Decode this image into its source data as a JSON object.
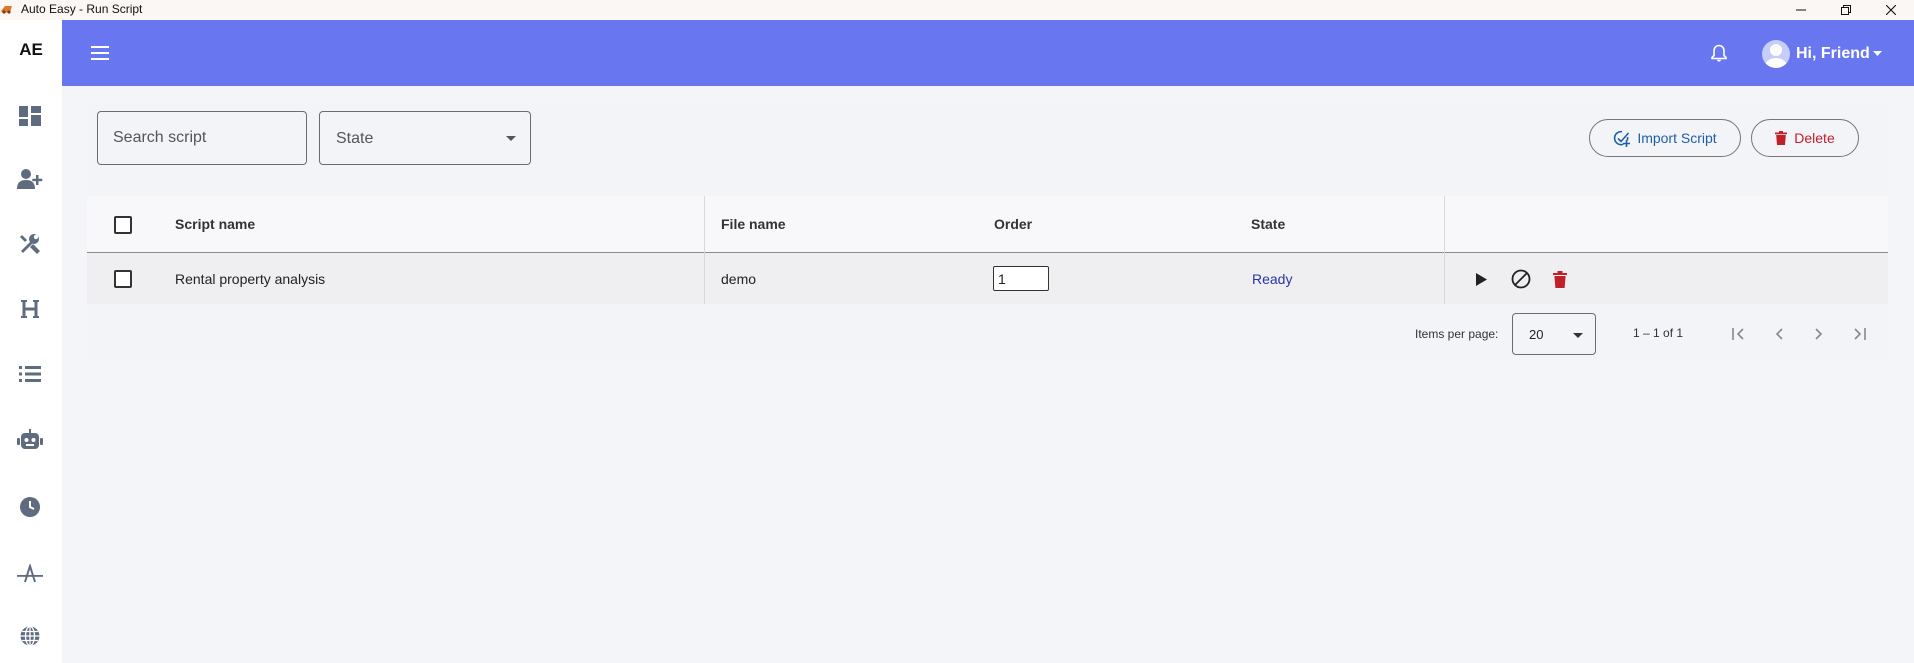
{
  "window": {
    "title": "Auto Easy - Run Script"
  },
  "sidebar": {
    "logo": "AE",
    "items": [
      {
        "icon": "dashboard-icon"
      },
      {
        "icon": "add-user-icon"
      },
      {
        "icon": "tools-icon"
      },
      {
        "icon": "heading-icon"
      },
      {
        "icon": "list-icon"
      },
      {
        "icon": "robot-icon"
      },
      {
        "icon": "clock-icon"
      },
      {
        "icon": "font-icon"
      },
      {
        "icon": "globe-icon"
      }
    ]
  },
  "header": {
    "greeting": "Hi, Friend",
    "accent_color": "#6877f0"
  },
  "toolbar": {
    "search_placeholder": "Search script",
    "state_filter_label": "State",
    "import_label": "Import Script",
    "delete_label": "Delete"
  },
  "table": {
    "columns": [
      "Script name",
      "File name",
      "Order",
      "State"
    ],
    "rows": [
      {
        "script_name": "Rental property analysis",
        "file_name": "demo",
        "order": "1",
        "state": "Ready"
      }
    ]
  },
  "paginator": {
    "items_per_page_label": "Items per page:",
    "items_per_page": "20",
    "range": "1 – 1 of 1"
  }
}
